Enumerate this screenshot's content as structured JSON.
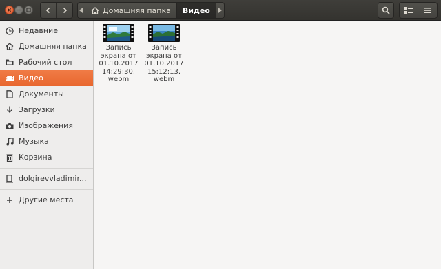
{
  "window": {
    "close_icon": "close-icon",
    "minimize_icon": "minimize-icon",
    "maximize_icon": "maximize-icon"
  },
  "toolbar": {
    "back_icon": "chevron-left-icon",
    "forward_icon": "chevron-right-icon",
    "search_icon": "search-icon",
    "view_icon": "grid-view-icon",
    "menu_icon": "hamburger-menu-icon"
  },
  "pathbar": {
    "crumbs": [
      {
        "label": "Домашняя папка",
        "icon": "home-icon"
      },
      {
        "label": "Видео"
      }
    ]
  },
  "sidebar": {
    "items": [
      {
        "label": "Недавние",
        "icon": "clock-icon"
      },
      {
        "label": "Домашняя папка",
        "icon": "home-icon"
      },
      {
        "label": "Рабочий стол",
        "icon": "folder-icon"
      },
      {
        "label": "Видео",
        "icon": "video-icon",
        "active": true
      },
      {
        "label": "Документы",
        "icon": "document-icon"
      },
      {
        "label": "Загрузки",
        "icon": "download-icon"
      },
      {
        "label": "Изображения",
        "icon": "camera-icon"
      },
      {
        "label": "Музыка",
        "icon": "music-icon"
      },
      {
        "label": "Корзина",
        "icon": "trash-icon"
      },
      {
        "label": "dolgirevvladimir...",
        "icon": "drive-icon"
      },
      {
        "label": "Другие места",
        "icon": "plus-icon"
      }
    ]
  },
  "files": [
    {
      "name": "Запись экрана от 01.10.2017 14:29:30.webm",
      "lines": [
        "Запись",
        "экрана от",
        "01.10.2017",
        "14:29:30.",
        "webm"
      ],
      "icon": "video-file-icon"
    },
    {
      "name": "Запись экрана от 01.10.2017 15:12:13.webm",
      "lines": [
        "Запись",
        "экрана от",
        "01.10.2017",
        "15:12:13.",
        "webm"
      ],
      "icon": "video-file-icon"
    }
  ],
  "colors": {
    "accent": "#e9672f",
    "headerbar": "#3a3935",
    "sidebar": "#eeedec",
    "content": "#f6f5f4"
  }
}
